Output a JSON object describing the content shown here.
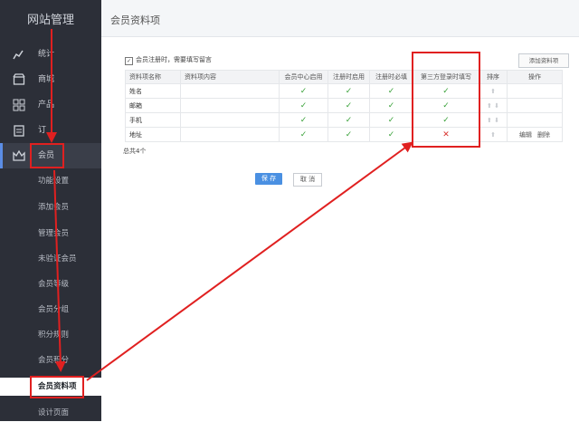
{
  "sidebar": {
    "brand": "网站管理",
    "items": [
      {
        "label": "统计",
        "icon": "chart-icon"
      },
      {
        "label": "商城",
        "icon": "shop-icon"
      },
      {
        "label": "产品",
        "icon": "grid-icon"
      },
      {
        "label": "订",
        "icon": "clipboard-icon"
      },
      {
        "label": "会员",
        "icon": "crown-icon"
      }
    ],
    "subitems": [
      "功能设置",
      "添加会员",
      "管理会员",
      "未验证会员",
      "会员等级",
      "会员分组",
      "积分规则",
      "会员积分",
      "会员资料项",
      "设计页面"
    ]
  },
  "page": {
    "title": "会员资料项",
    "option_label": "会员注册时，需要填写留言",
    "add_button": "添加资料项",
    "total": "总共4个",
    "save": "保 存",
    "cancel": "取 消"
  },
  "table": {
    "headers": [
      "资料项名称",
      "资料项内容",
      "会员中心启用",
      "注册时启用",
      "注册时必填",
      "第三方登录时填写",
      "排序",
      "操作"
    ],
    "rows": [
      {
        "name": "姓名",
        "content": "",
        "center": "✓",
        "reg": "✓",
        "req": "✓",
        "third": "✓",
        "sort": "⬆",
        "ops": []
      },
      {
        "name": "邮箱",
        "content": "",
        "center": "✓",
        "reg": "✓",
        "req": "✓",
        "third": "✓",
        "sort": "⬆ ⬇",
        "ops": []
      },
      {
        "name": "手机",
        "content": "",
        "center": "✓",
        "reg": "✓",
        "req": "✓",
        "third": "✓",
        "sort": "⬆ ⬇",
        "ops": []
      },
      {
        "name": "地址",
        "content": "",
        "center": "✓",
        "reg": "✓",
        "req": "✓",
        "third": "✕",
        "sort": "⬆",
        "ops": [
          "编辑",
          "删除"
        ]
      }
    ]
  },
  "colors": {
    "annotation": "#e02020",
    "check": "#3aa23a",
    "sidebar": "#2c2f38",
    "primary": "#4a90e2"
  }
}
